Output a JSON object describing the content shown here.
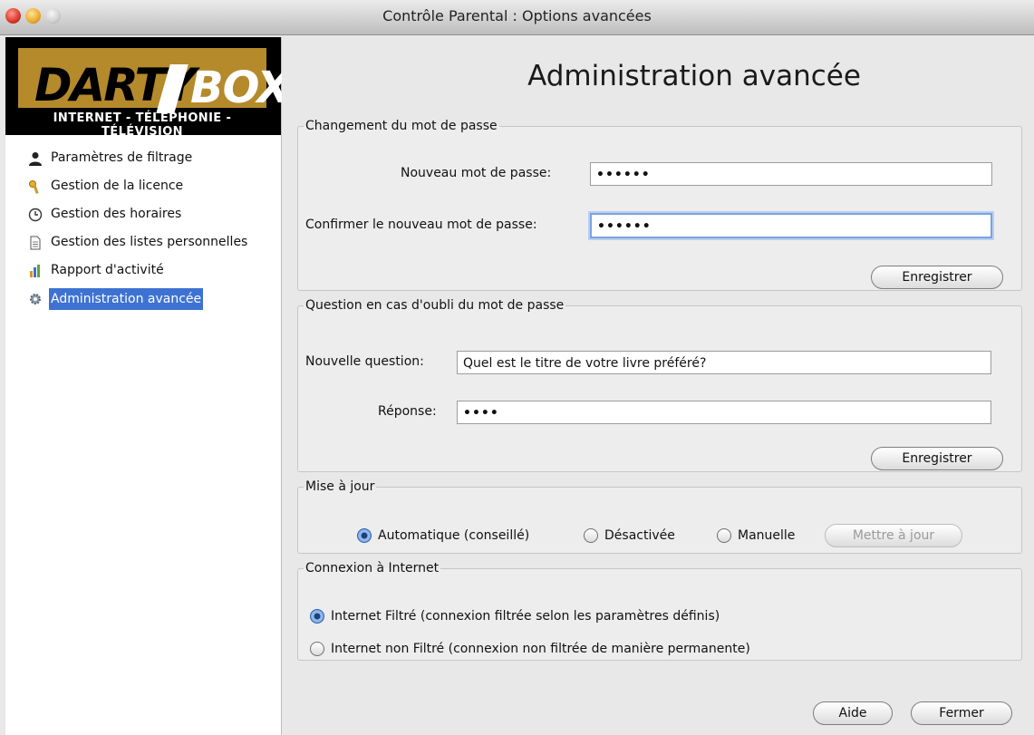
{
  "window": {
    "title": "Contrôle Parental : Options avancées"
  },
  "logo": {
    "brand_left": "DARTY",
    "brand_right": "BOX",
    "tagline": "INTERNET - TÉLÉPHONIE - TÉLÉVISION"
  },
  "sidebar": {
    "items": [
      {
        "label": "Paramètres de filtrage",
        "icon": "person-icon"
      },
      {
        "label": "Gestion de la licence",
        "icon": "key-icon"
      },
      {
        "label": "Gestion des horaires",
        "icon": "clock-icon"
      },
      {
        "label": "Gestion des listes personnelles",
        "icon": "document-icon"
      },
      {
        "label": "Rapport d'activité",
        "icon": "report-icon"
      },
      {
        "label": "Administration avancée",
        "icon": "gear-icon",
        "selected": true
      }
    ]
  },
  "main": {
    "heading": "Administration avancée",
    "password_group": {
      "title": "Changement du mot de passe",
      "new_label": "Nouveau mot de passe:",
      "new_value": "••••••",
      "confirm_label": "Confirmer le nouveau mot de passe:",
      "confirm_value": "••••••",
      "save_label": "Enregistrer"
    },
    "question_group": {
      "title": "Question en cas d'oubli du mot de passe",
      "question_label": "Nouvelle question:",
      "question_value": "Quel est le titre de votre livre préféré?",
      "answer_label": "Réponse:",
      "answer_value": "••••",
      "save_label": "Enregistrer"
    },
    "update_group": {
      "title": "Mise à jour",
      "options": [
        {
          "label": "Automatique (conseillé)",
          "selected": true
        },
        {
          "label": "Désactivée",
          "selected": false
        },
        {
          "label": "Manuelle",
          "selected": false
        }
      ],
      "update_button": "Mettre à jour"
    },
    "connection_group": {
      "title": "Connexion à Internet",
      "options": [
        {
          "label": "Internet Filtré (connexion filtrée selon les paramètres définis)",
          "selected": true
        },
        {
          "label": "Internet non Filtré (connexion non filtrée de manière permanente)",
          "selected": false
        }
      ]
    },
    "footer": {
      "help_label": "Aide",
      "close_label": "Fermer"
    }
  }
}
